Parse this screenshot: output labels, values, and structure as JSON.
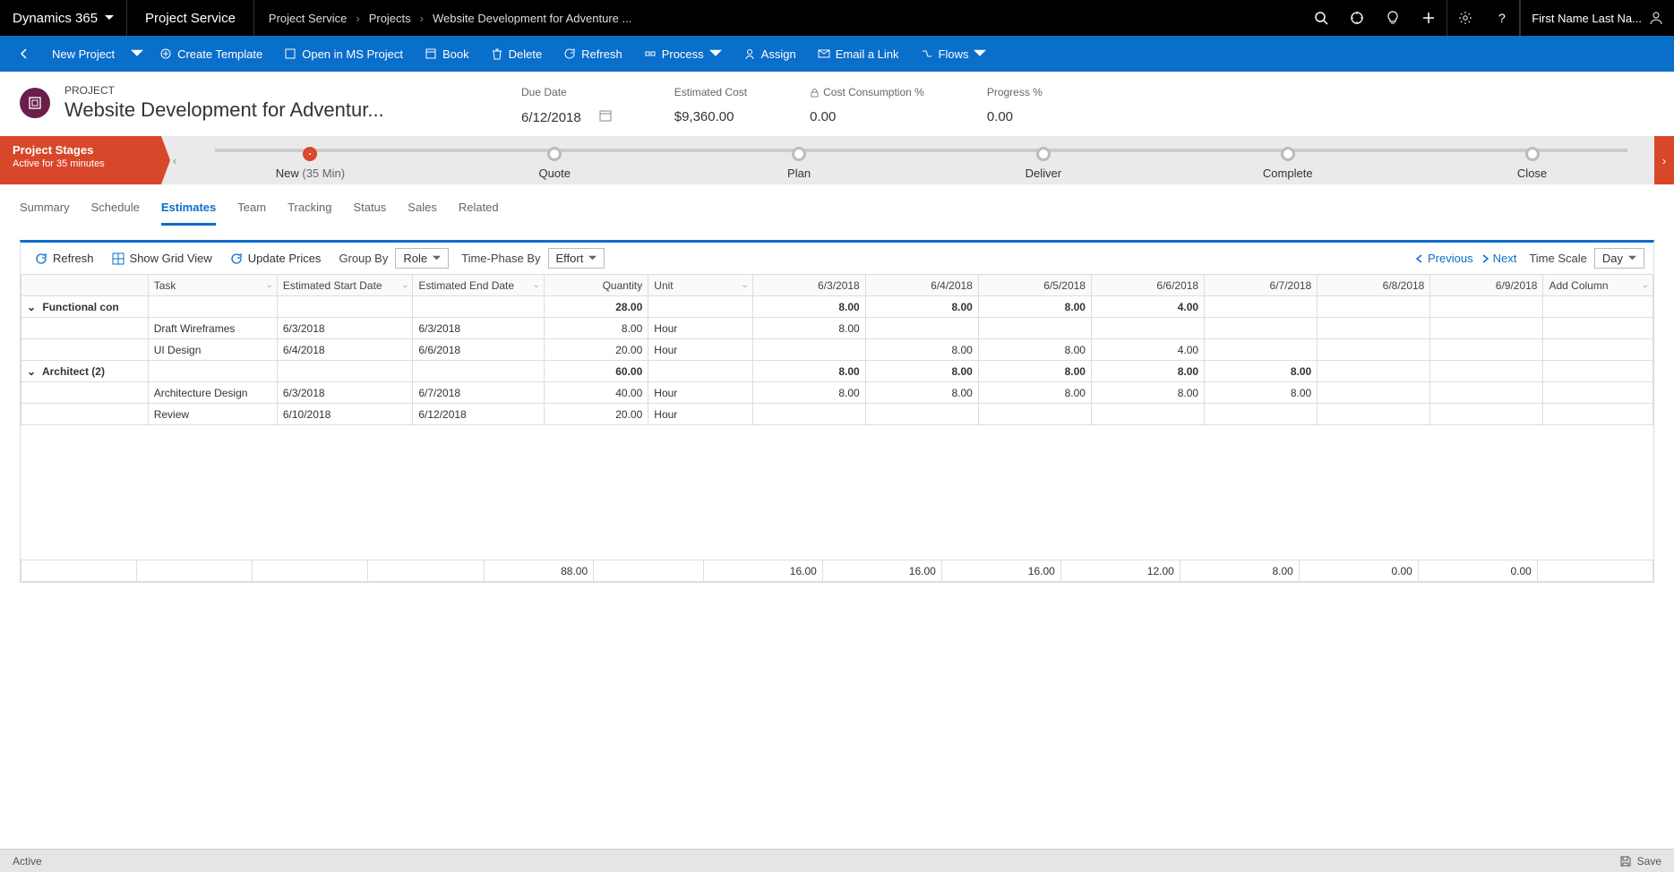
{
  "topbar": {
    "brand": "Dynamics 365",
    "app": "Project Service",
    "crumbs": [
      "Project Service",
      "Projects",
      "Website Development for Adventure ..."
    ],
    "user": "First Name Last Na..."
  },
  "cmdbar": {
    "new_project": "New Project",
    "create_template": "Create Template",
    "open_ms": "Open in MS Project",
    "book": "Book",
    "delete": "Delete",
    "refresh": "Refresh",
    "process": "Process",
    "assign": "Assign",
    "email": "Email a Link",
    "flows": "Flows"
  },
  "header": {
    "entity_label": "PROJECT",
    "title": "Website Development for Adventur...",
    "due_date_label": "Due Date",
    "due_date": "6/12/2018",
    "est_cost_label": "Estimated Cost",
    "est_cost": "$9,360.00",
    "cost_cons_label": "Cost Consumption %",
    "cost_cons": "0.00",
    "progress_label": "Progress %",
    "progress": "0.00"
  },
  "process": {
    "badge_title": "Project Stages",
    "badge_sub": "Active for 35 minutes",
    "stages": [
      {
        "label": "New",
        "meta": "(35 Min)",
        "active": true
      },
      {
        "label": "Quote"
      },
      {
        "label": "Plan"
      },
      {
        "label": "Deliver"
      },
      {
        "label": "Complete"
      },
      {
        "label": "Close"
      }
    ]
  },
  "tabs": [
    "Summary",
    "Schedule",
    "Estimates",
    "Team",
    "Tracking",
    "Status",
    "Sales",
    "Related"
  ],
  "active_tab": "Estimates",
  "gridtoolbar": {
    "refresh": "Refresh",
    "show_grid": "Show Grid View",
    "update_prices": "Update Prices",
    "group_by_label": "Group By",
    "group_by": "Role",
    "time_phase_label": "Time-Phase By",
    "time_phase": "Effort",
    "previous": "Previous",
    "next": "Next",
    "time_scale_label": "Time Scale",
    "time_scale": "Day"
  },
  "columns": {
    "task": "Task",
    "est_start": "Estimated Start Date",
    "est_end": "Estimated End Date",
    "quantity": "Quantity",
    "unit": "Unit",
    "dates": [
      "6/3/2018",
      "6/4/2018",
      "6/5/2018",
      "6/6/2018",
      "6/7/2018",
      "6/8/2018",
      "6/9/2018"
    ],
    "add_col": "Add Column"
  },
  "rows": [
    {
      "type": "group",
      "task": "Functional con",
      "quantity": "28.00",
      "d": [
        "8.00",
        "8.00",
        "8.00",
        "4.00",
        "",
        "",
        ""
      ]
    },
    {
      "type": "row",
      "task": "Draft Wireframes",
      "start": "6/3/2018",
      "end": "6/3/2018",
      "quantity": "8.00",
      "unit": "Hour",
      "d": [
        "8.00",
        "",
        "",
        "",
        "",
        "",
        ""
      ]
    },
    {
      "type": "row",
      "task": "UI Design",
      "start": "6/4/2018",
      "end": "6/6/2018",
      "quantity": "20.00",
      "unit": "Hour",
      "d": [
        "",
        "8.00",
        "8.00",
        "4.00",
        "",
        "",
        ""
      ]
    },
    {
      "type": "group",
      "task": "Architect (2)",
      "quantity": "60.00",
      "d": [
        "8.00",
        "8.00",
        "8.00",
        "8.00",
        "8.00",
        "",
        ""
      ]
    },
    {
      "type": "row",
      "task": "Architecture Design",
      "start": "6/3/2018",
      "end": "6/7/2018",
      "quantity": "40.00",
      "unit": "Hour",
      "d": [
        "8.00",
        "8.00",
        "8.00",
        "8.00",
        "8.00",
        "",
        ""
      ]
    },
    {
      "type": "row",
      "task": "Review",
      "start": "6/10/2018",
      "end": "6/12/2018",
      "quantity": "20.00",
      "unit": "Hour",
      "d": [
        "",
        "",
        "",
        "",
        "",
        "",
        ""
      ]
    }
  ],
  "footer_totals": {
    "quantity": "88.00",
    "d": [
      "16.00",
      "16.00",
      "16.00",
      "12.00",
      "8.00",
      "0.00",
      "0.00"
    ]
  },
  "statusbar": {
    "status": "Active",
    "save": "Save"
  }
}
